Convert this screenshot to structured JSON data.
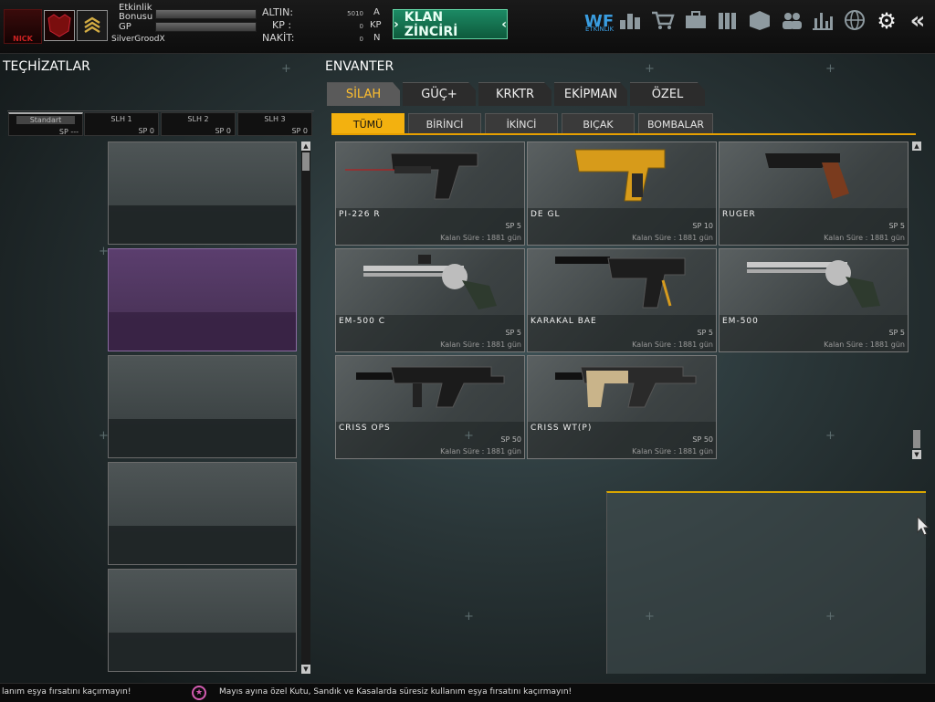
{
  "header": {
    "logo_text": "NICK",
    "event_label": "Etkinlik\nBonusu",
    "event_label_1": "Etkinlik",
    "event_label_2": "Bonusu",
    "gp_label": "GP",
    "username": "SilverGroodX",
    "currency": {
      "altin_label": "ALTIN:",
      "altin_value": "5010",
      "altin_unit": "A",
      "kp_label": "KP :",
      "kp_value": "0",
      "kp_unit": "KP",
      "nakit_label": "NAKİT:",
      "nakit_value": "0",
      "nakit_unit": "N"
    },
    "clan_button": "KLAN ZİNCİRİ",
    "event_icon_label": "ETKİNLİK"
  },
  "left_panel": {
    "title": "TEÇHİZATLAR",
    "tabs": [
      {
        "name": "Standart",
        "sp": "SP ---"
      },
      {
        "name": "SLH 1",
        "sp": "SP 0"
      },
      {
        "name": "SLH 2",
        "sp": "SP 0"
      },
      {
        "name": "SLH 3",
        "sp": "SP 0"
      }
    ]
  },
  "right_panel": {
    "title": "ENVANTER",
    "main_tabs": [
      "SİLAH",
      "GÜÇ+",
      "KRKTR",
      "EKİPMAN",
      "ÖZEL"
    ],
    "sub_tabs": [
      "TÜMÜ",
      "BİRİNCİ",
      "İKİNCİ",
      "BIÇAK",
      "BOMBALAR"
    ],
    "items": [
      {
        "name": "PI-226 R",
        "sp": "SP 5",
        "remaining": "Kalan Süre : 1881 gün"
      },
      {
        "name": "DE GL",
        "sp": "SP 10",
        "remaining": "Kalan Süre : 1881 gün"
      },
      {
        "name": "RUGER",
        "sp": "SP 5",
        "remaining": "Kalan Süre : 1881 gün"
      },
      {
        "name": "EM-500 C",
        "sp": "SP 5",
        "remaining": "Kalan Süre : 1881 gün"
      },
      {
        "name": "KARAKAL BAE",
        "sp": "SP 5",
        "remaining": "Kalan Süre : 1881 gün"
      },
      {
        "name": "EM-500",
        "sp": "SP 5",
        "remaining": "Kalan Süre : 1881 gün"
      },
      {
        "name": "CRISS OPS",
        "sp": "SP 50",
        "remaining": "Kalan Süre : 1881 gün"
      },
      {
        "name": "CRISS WT(P)",
        "sp": "SP 50",
        "remaining": "Kalan Süre : 1881 gün"
      }
    ]
  },
  "ticker": {
    "left_text": "lanım eşya fırsatını kaçırmayın!",
    "main_text": "Mayıs ayına özel Kutu, Sandık ve Kasalarda süresiz kullanım eşya fırsatını kaçırmayın!"
  },
  "colors": {
    "accent": "#f3b10f",
    "clan_button": "#1c8a64",
    "highlight_slot": "#5b2a6e"
  }
}
